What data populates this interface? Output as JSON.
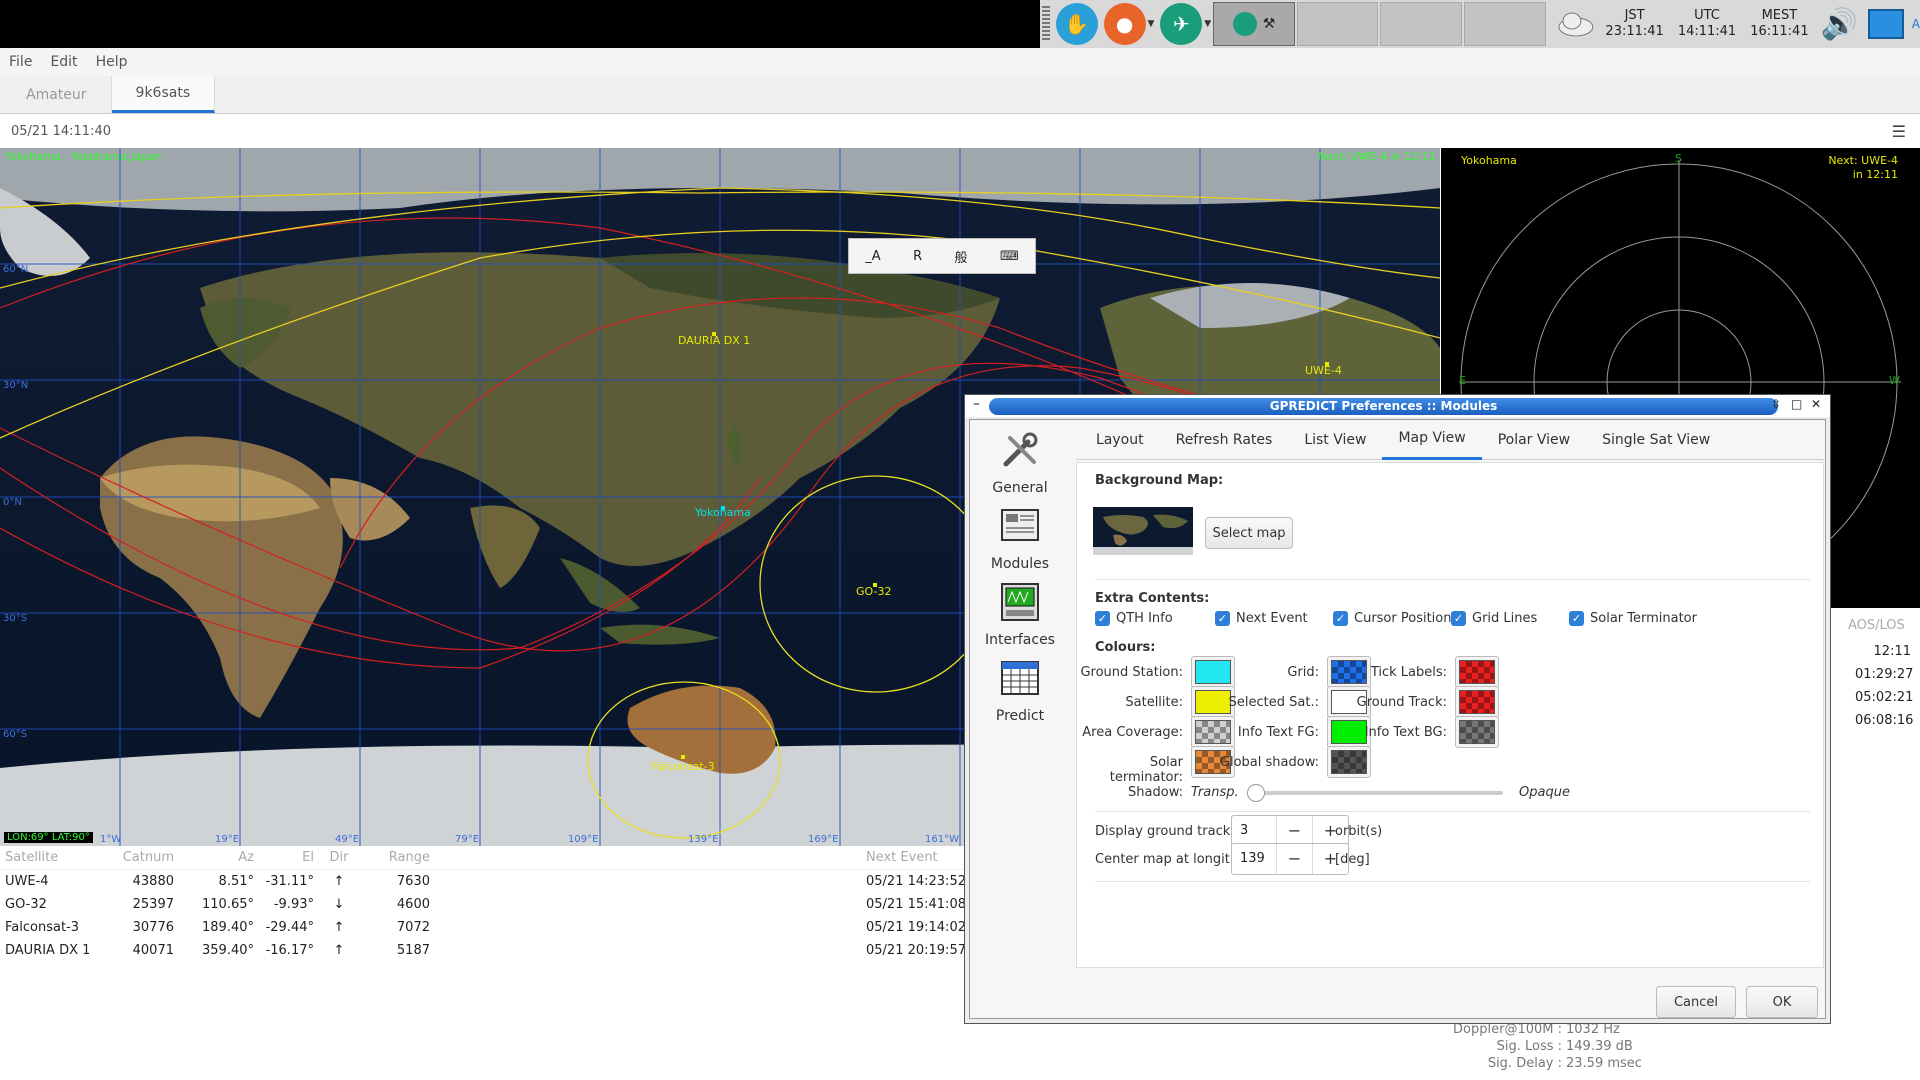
{
  "panel": {
    "clocks": [
      {
        "zone": "JST",
        "time": "23:11:41"
      },
      {
        "zone": "UTC",
        "time": "14:11:41"
      },
      {
        "zone": "MEST",
        "time": "16:11:41"
      }
    ]
  },
  "menu": [
    "File",
    "Edit",
    "Help"
  ],
  "module_tabs": [
    {
      "label": "Amateur"
    },
    {
      "label": "9k6sats"
    }
  ],
  "status_time": "05/21 14:11:40",
  "map": {
    "qth_info": "Yokohama · Yokohama,Japan",
    "next_event": "Next: UWE-4 in 12:11",
    "qth_name": "Yokohama",
    "cursor_position": "LON:69° LAT:90°",
    "lat_labels": [
      "60°N",
      "30°N",
      "0°N",
      "30°S",
      "60°S"
    ],
    "lon_labels": [
      "1°W",
      "19°E",
      "49°E",
      "79°E",
      "109°E",
      "139°E",
      "169°E",
      "161°W"
    ],
    "satellites": [
      "DAURIA DX 1",
      "UWE-4",
      "GO-32",
      "Falconsat-3"
    ],
    "colors": {
      "satellite": "#e8e800",
      "qth": "#00e5e5",
      "track": "#d42020",
      "info": "#33ff33",
      "grid": "#1f4fbf"
    }
  },
  "popup_toolbar": [
    "_A",
    "R",
    "般",
    "⌨"
  ],
  "polar": {
    "qth": "Yokohama",
    "next_line1": "Next: UWE-4",
    "next_line2": "in 12:11",
    "n": "S",
    "e": "E",
    "w": "W"
  },
  "satlist": {
    "headers": [
      "Satellite",
      "Catnum",
      "Az",
      "El",
      "Dir",
      "Range",
      "Next Event"
    ],
    "rows": [
      {
        "name": "UWE-4",
        "catnum": "43880",
        "az": "8.51°",
        "el": "-31.11°",
        "dir": "↑",
        "range": "7630",
        "next": "05/21 14:23:52"
      },
      {
        "name": "GO-32",
        "catnum": "25397",
        "az": "110.65°",
        "el": "-9.93°",
        "dir": "↓",
        "range": "4600",
        "next": "05/21 15:41:08"
      },
      {
        "name": "Falconsat-3",
        "catnum": "30776",
        "az": "189.40°",
        "el": "-29.44°",
        "dir": "↑",
        "range": "7072",
        "next": "05/21 19:14:02"
      },
      {
        "name": "DAURIA DX 1",
        "catnum": "40071",
        "az": "359.40°",
        "el": "-16.17°",
        "dir": "↑",
        "range": "5187",
        "next": "05/21 20:19:57"
      }
    ]
  },
  "aos": {
    "header": "AOS/LOS",
    "values": [
      "12:11",
      "01:29:27",
      "05:02:21",
      "06:08:16"
    ]
  },
  "details": [
    {
      "label": "Doppler@100M :",
      "value": "1032 Hz"
    },
    {
      "label": "Sig. Loss :",
      "value": "149.39 dB"
    },
    {
      "label": "Sig. Delay :",
      "value": "23.59 msec"
    }
  ],
  "dialog": {
    "title": "GPREDICT Preferences :: Modules",
    "sidebar": [
      "General",
      "Modules",
      "Interfaces",
      "Predict"
    ],
    "tabs": [
      "Layout",
      "Refresh Rates",
      "List View",
      "Map View",
      "Polar View",
      "Single Sat View"
    ],
    "active_tab": "Map View",
    "background_map_title": "Background Map:",
    "select_map": "Select map",
    "extra_title": "Extra Contents:",
    "extras": [
      "QTH Info",
      "Next Event",
      "Cursor Position",
      "Grid Lines",
      "Solar Terminator"
    ],
    "colours_title": "Colours:",
    "colours": {
      "ground_station": {
        "label": "Ground Station:",
        "color": "#22e6f0"
      },
      "grid": {
        "label": "Grid:",
        "color": "#1e6fe8"
      },
      "tick_labels": {
        "label": "Tick Labels:",
        "color": "#e82020"
      },
      "satellite": {
        "label": "Satellite:",
        "color": "#eeee00"
      },
      "selected_sat": {
        "label": "Selected Sat.:",
        "color": "#ffffff"
      },
      "ground_track": {
        "label": "Ground Track:",
        "color": "#e82020"
      },
      "area_coverage": {
        "label": "Area Coverage:",
        "color": "#cfcfcf"
      },
      "info_text_fg": {
        "label": "Info Text FG:",
        "color": "#00ee00"
      },
      "info_text_bg": {
        "label": "Info Text BG:",
        "color": "#777777"
      },
      "solar_terminator": {
        "label": "Solar terminator:",
        "color": "#e8883a"
      },
      "global_shadow": {
        "label": "Global shadow:",
        "color": "#555555"
      }
    },
    "shadow_label": "Shadow:",
    "shadow_min": "Transp.",
    "shadow_max": "Opaque",
    "shadow_value": 0,
    "ground_track_label": "Display ground track for",
    "ground_track_value": "3",
    "ground_track_unit": "orbit(s)",
    "center_label": "Center map at longitude",
    "center_value": "139",
    "center_unit": "[deg]",
    "cancel": "Cancel",
    "ok": "OK"
  }
}
